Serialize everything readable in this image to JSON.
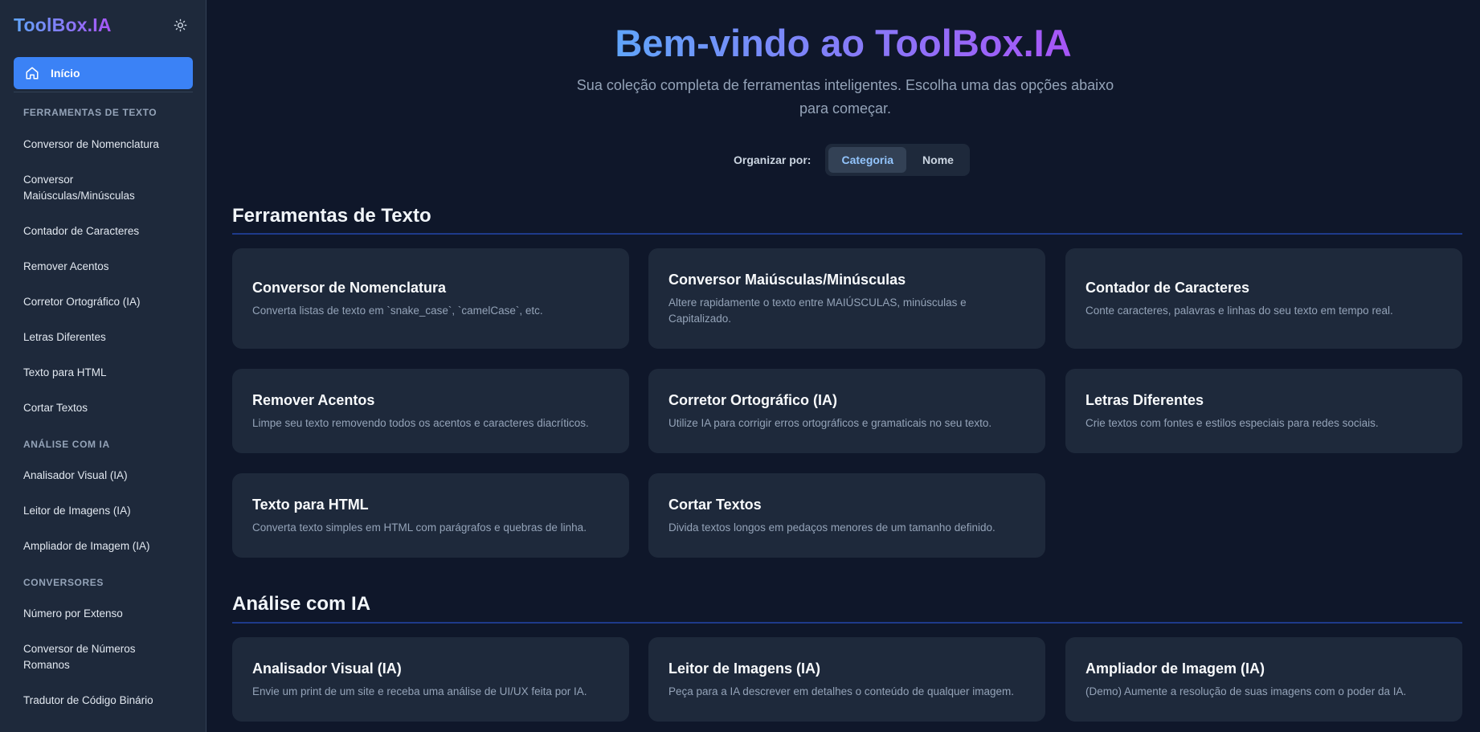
{
  "sidebar": {
    "brand": "ToolBox.IA",
    "theme_toggle_icon": "sun-icon",
    "home": {
      "icon": "home-icon",
      "label": "Início"
    },
    "sections": [
      {
        "heading": "FERRAMENTAS DE TEXTO",
        "items": [
          "Conversor de Nomenclatura",
          "Conversor Maiúsculas/Minúsculas",
          "Contador de Caracteres",
          "Remover Acentos",
          "Corretor Ortográfico (IA)",
          "Letras Diferentes",
          "Texto para HTML",
          "Cortar Textos"
        ]
      },
      {
        "heading": "ANÁLISE COM IA",
        "items": [
          "Analisador Visual (IA)",
          "Leitor de Imagens (IA)",
          "Ampliador de Imagem (IA)"
        ]
      },
      {
        "heading": "CONVERSORES",
        "items": [
          "Número por Extenso",
          "Conversor de Números Romanos",
          "Tradutor de Código Binário"
        ]
      }
    ]
  },
  "hero": {
    "title": "Bem-vindo ao ToolBox.IA",
    "subtitle": "Sua coleção completa de ferramentas inteligentes. Escolha uma das opções abaixo para começar."
  },
  "sort": {
    "label": "Organizar por:",
    "options": [
      "Categoria",
      "Nome"
    ],
    "selected": "Categoria"
  },
  "sections": [
    {
      "title": "Ferramentas de Texto",
      "cards": [
        {
          "title": "Conversor de Nomenclatura",
          "desc": "Converta listas de texto em `snake_case`, `camelCase`, etc."
        },
        {
          "title": "Conversor Maiúsculas/Minúsculas",
          "desc": "Altere rapidamente o texto entre MAIÚSCULAS, minúsculas e Capitalizado."
        },
        {
          "title": "Contador de Caracteres",
          "desc": "Conte caracteres, palavras e linhas do seu texto em tempo real."
        },
        {
          "title": "Remover Acentos",
          "desc": "Limpe seu texto removendo todos os acentos e caracteres diacríticos."
        },
        {
          "title": "Corretor Ortográfico (IA)",
          "desc": "Utilize IA para corrigir erros ortográficos e gramaticais no seu texto."
        },
        {
          "title": "Letras Diferentes",
          "desc": "Crie textos com fontes e estilos especiais para redes sociais."
        },
        {
          "title": "Texto para HTML",
          "desc": "Converta texto simples em HTML com parágrafos e quebras de linha."
        },
        {
          "title": "Cortar Textos",
          "desc": "Divida textos longos em pedaços menores de um tamanho definido."
        }
      ]
    },
    {
      "title": "Análise com IA",
      "cards": [
        {
          "title": "Analisador Visual (IA)",
          "desc": "Envie um print de um site e receba uma análise de UI/UX feita por IA."
        },
        {
          "title": "Leitor de Imagens (IA)",
          "desc": "Peça para a IA descrever em detalhes o conteúdo de qualquer imagem."
        },
        {
          "title": "Ampliador de Imagem (IA)",
          "desc": "(Demo) Aumente a resolução de suas imagens com o poder da IA."
        }
      ]
    }
  ],
  "colors": {
    "accent": "#3b82f6",
    "background": "#0f172a",
    "card": "#1e293b",
    "gradient_start": "#60a5fa",
    "gradient_end": "#a855f7"
  }
}
